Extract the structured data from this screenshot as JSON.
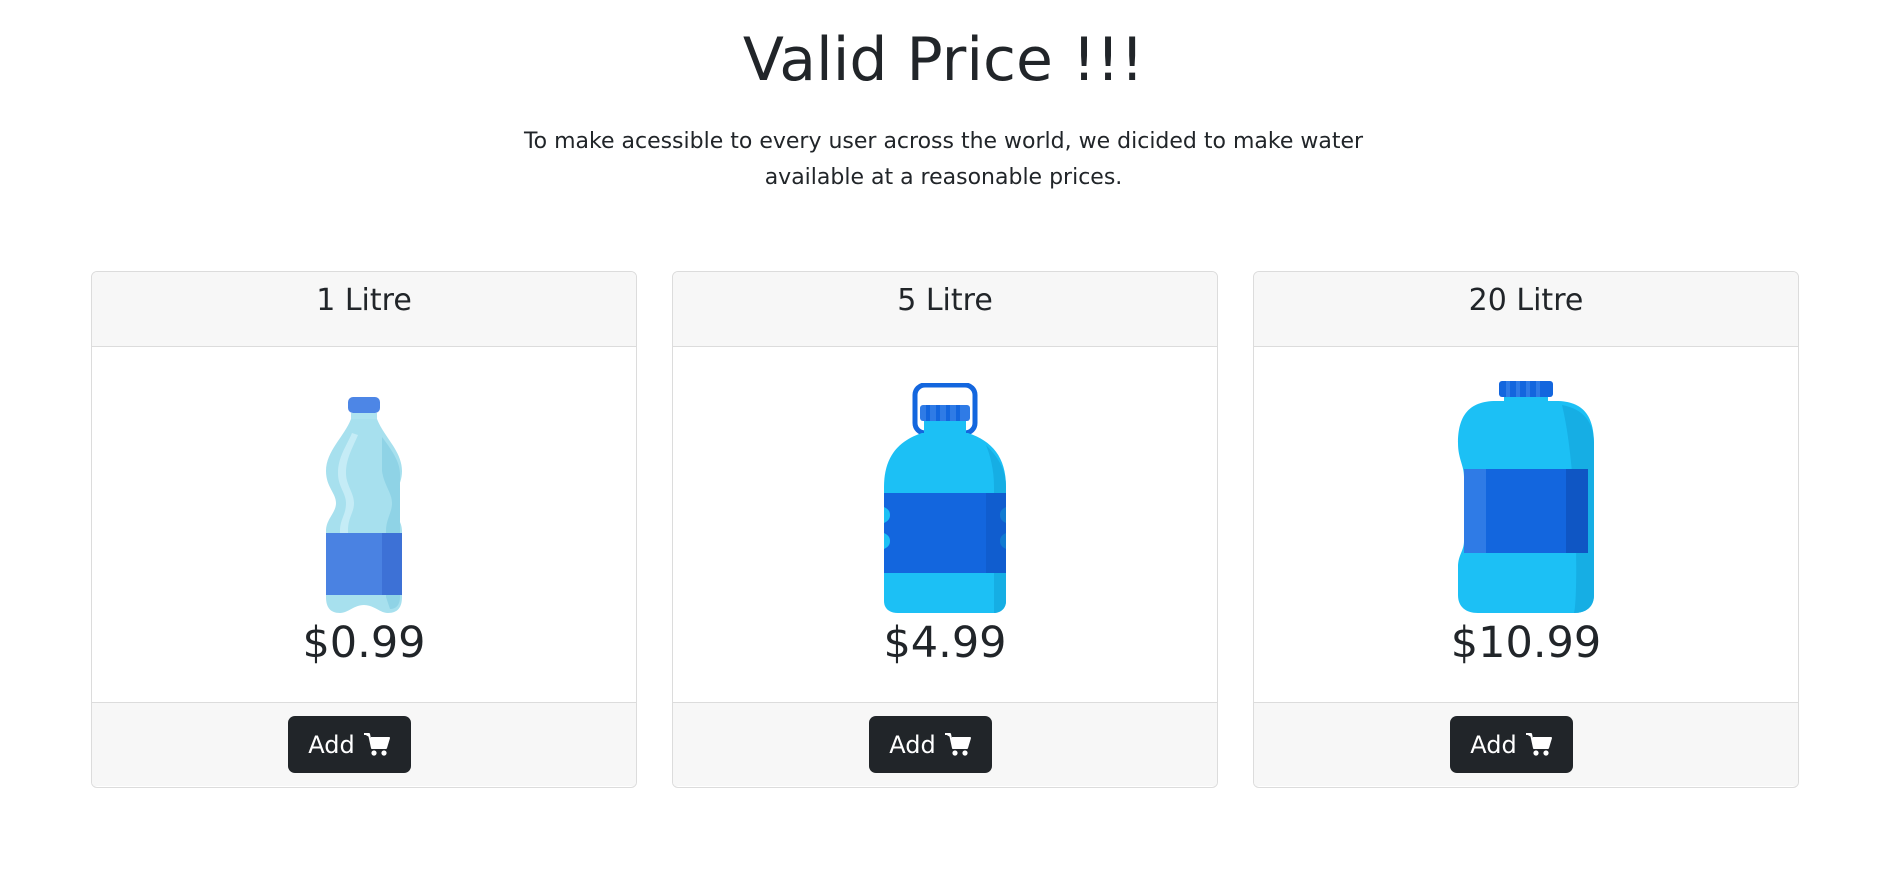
{
  "page": {
    "title": "Valid Price !!!",
    "lead": "To make acessible to every user across the world, we dicided to make water available at a reasonable prices."
  },
  "products": [
    {
      "size": "1 Litre",
      "price": "$0.99",
      "button_label": "Add",
      "icon": "small-bottle-icon"
    },
    {
      "size": "5 Litre",
      "price": "$4.99",
      "button_label": "Add",
      "icon": "handle-bottle-icon"
    },
    {
      "size": "20 Litre",
      "price": "$10.99",
      "button_label": "Add",
      "icon": "large-jug-icon"
    }
  ],
  "icons": {
    "cart": "shopping-cart-icon"
  },
  "colors": {
    "button_bg": "#212529",
    "card_header_bg": "#f7f7f7",
    "light_blue": "#1cc0f5",
    "dark_blue": "#1366de",
    "pale_blue": "#9fdcec"
  }
}
